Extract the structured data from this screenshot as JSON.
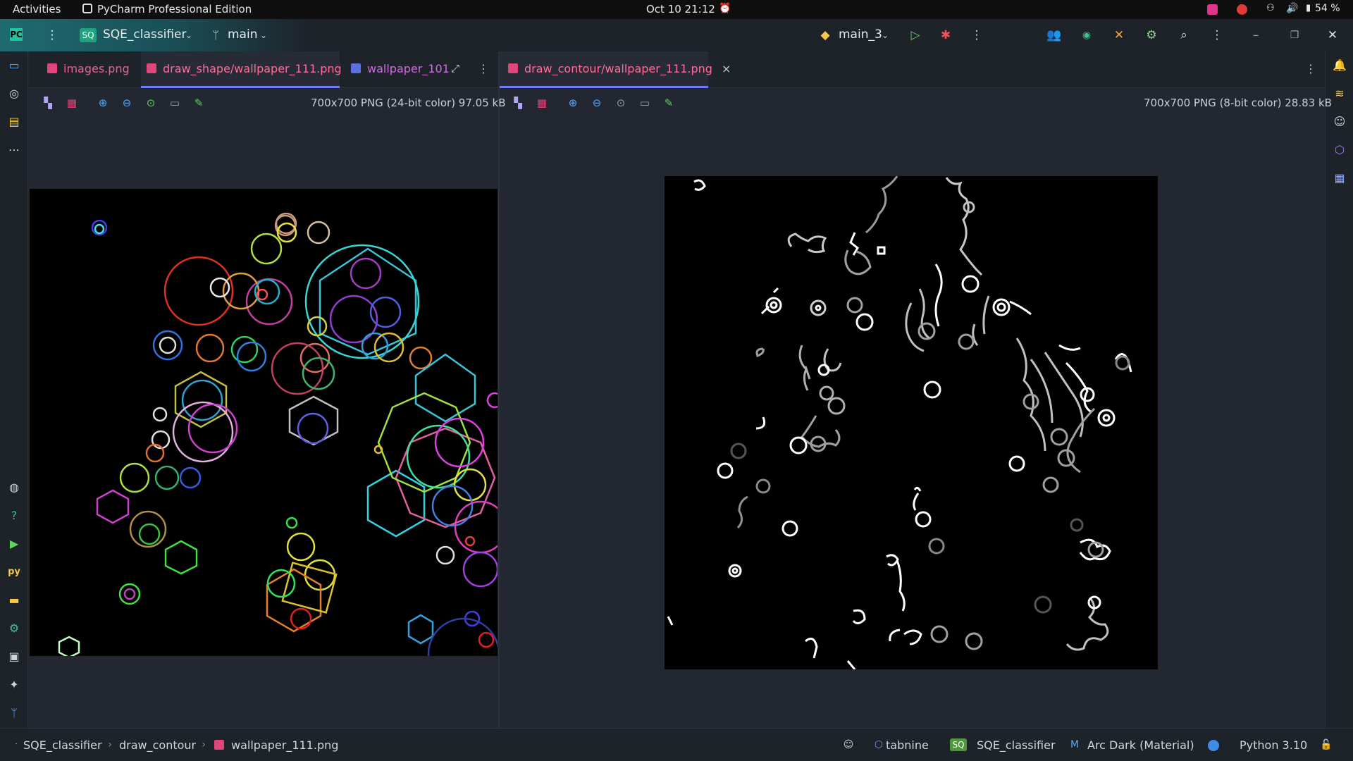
{
  "system_bar": {
    "activities": "Activities",
    "app_name": "PyCharm Professional Edition",
    "clock": "Oct 10  21:12",
    "battery": "54 %"
  },
  "header": {
    "project_badge": "SQ",
    "project_name": "SQE_classifier",
    "branch": "main",
    "run_config": "main_3"
  },
  "left_pane": {
    "tabs": [
      {
        "label": "images.png",
        "active": false
      },
      {
        "label": "draw_shape/wallpaper_111.png",
        "active": true
      },
      {
        "label": "wallpaper_101",
        "active": false
      }
    ],
    "image_info": "700x700 PNG (24-bit color) 97.05 kB"
  },
  "right_pane": {
    "tabs": [
      {
        "label": "draw_contour/wallpaper_111.png",
        "active": true
      }
    ],
    "image_info": "700x700 PNG (8-bit color) 28.83 kB"
  },
  "status_bar": {
    "breadcrumb": [
      "SQE_classifier",
      "draw_contour",
      "wallpaper_111.png"
    ],
    "tabnine": "tabnine",
    "project_badge": "SQ",
    "project": "SQE_classifier",
    "theme": "Arc Dark (Material)",
    "interpreter": "Python 3.10"
  },
  "colors": {
    "accent": "#6d7cf0",
    "tab_active_text": "#ff6b9a",
    "image_tab_icon": "#e0457b"
  }
}
